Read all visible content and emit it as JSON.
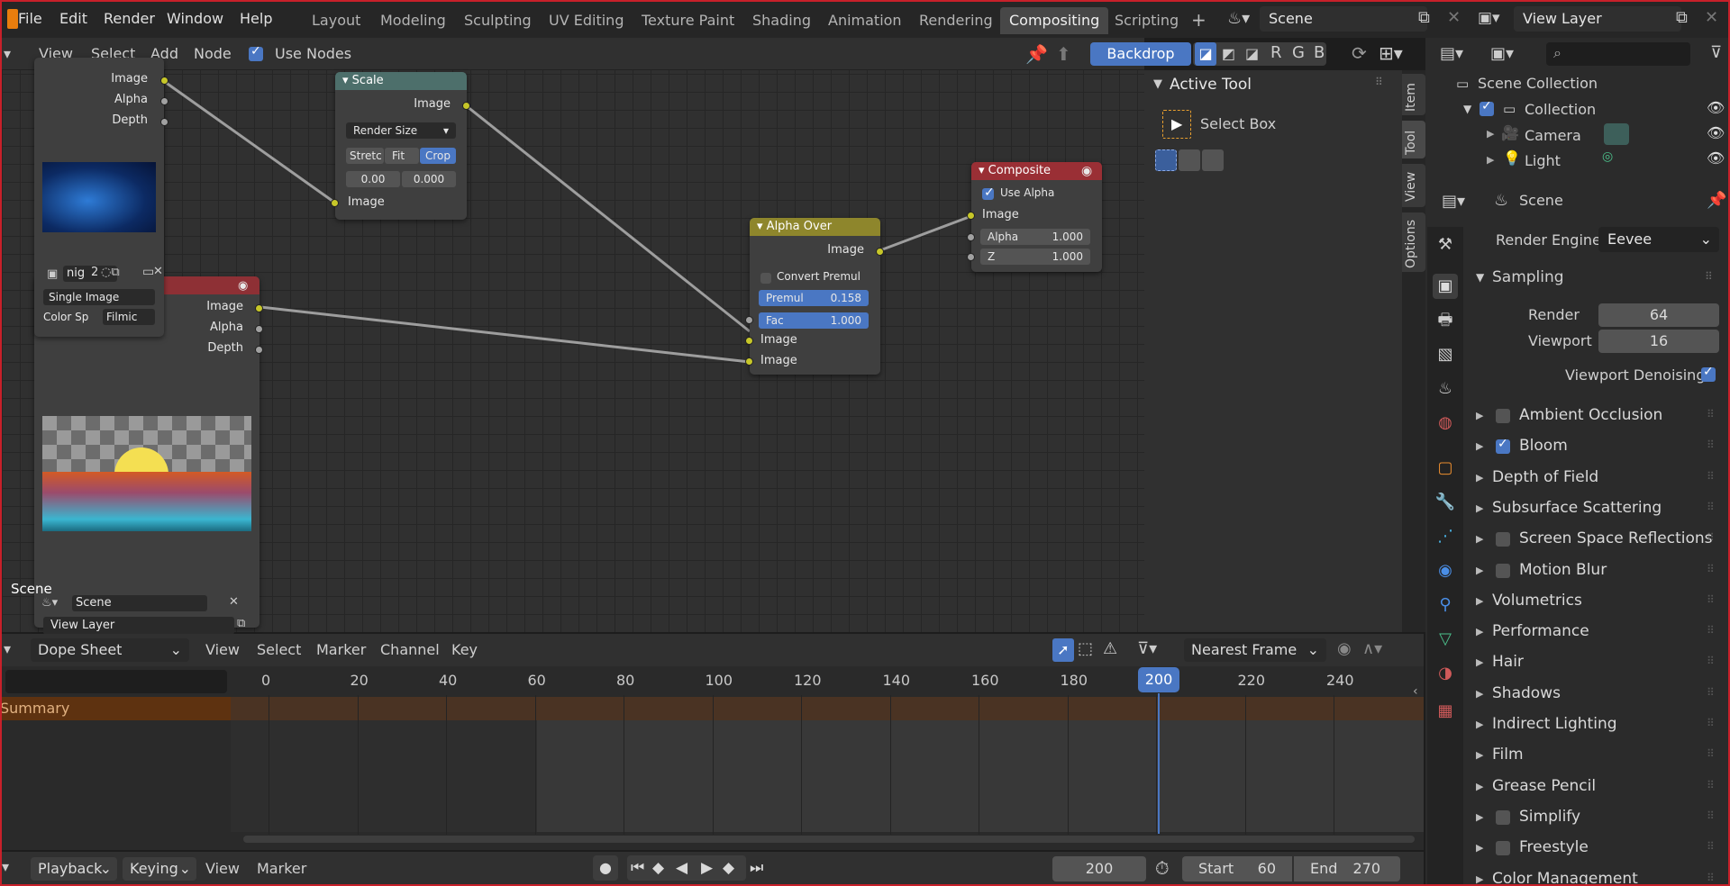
{
  "top_menu": [
    "File",
    "Edit",
    "Render",
    "Window",
    "Help"
  ],
  "workspaces": [
    "Layout",
    "Modeling",
    "Sculpting",
    "UV Editing",
    "Texture Paint",
    "Shading",
    "Animation",
    "Rendering",
    "Compositing",
    "Scripting"
  ],
  "active_workspace": "Compositing",
  "scene_name": "Scene",
  "view_layer": "View Layer",
  "node_header": {
    "items": [
      "View",
      "Select",
      "Add",
      "Node"
    ],
    "use_nodes": "Use Nodes",
    "backdrop": "Backdrop",
    "channels": [
      "R",
      "G",
      "B"
    ]
  },
  "nodes": {
    "render_layers": {
      "outputs": [
        "Image",
        "Alpha",
        "Depth"
      ],
      "scene": "Scene",
      "scene_label": "Scene",
      "view_layer": "View Layer"
    },
    "image_node": {
      "outputs": [
        "Image",
        "Alpha",
        "Depth"
      ],
      "image_name": "nig",
      "users": "2",
      "source": "Single Image",
      "color_space_label": "Color Sp",
      "color_space": "Filmic"
    },
    "scale": {
      "title": "Scale",
      "out": "Image",
      "space": "Render Size",
      "modes": [
        "Stretc",
        "Fit",
        "Crop"
      ],
      "x": "0.00",
      "y": "0.000",
      "in": "Image"
    },
    "alpha_over": {
      "title": "Alpha Over",
      "out": "Image",
      "convert": "Convert Premul",
      "premul_label": "Premul",
      "premul": "0.158",
      "fac_label": "Fac",
      "fac": "1.000",
      "in1": "Image",
      "in2": "Image"
    },
    "composite": {
      "title": "Composite",
      "use_alpha": "Use Alpha",
      "in": "Image",
      "alpha_label": "Alpha",
      "alpha": "1.000",
      "z_label": "Z",
      "z": "1.000"
    }
  },
  "npanel": {
    "title": "Active Tool",
    "tool": "Select Box",
    "tabs": [
      "Item",
      "Tool",
      "View",
      "Options"
    ]
  },
  "outliner": {
    "root": "Scene Collection",
    "collection": "Collection",
    "items": [
      "Camera",
      "Light"
    ]
  },
  "properties": {
    "scene": "Scene",
    "render_engine_label": "Render Engine",
    "render_engine": "Eevee",
    "sampling": "Sampling",
    "render_label": "Render",
    "render": "64",
    "viewport_label": "Viewport",
    "viewport": "16",
    "denoise": "Viewport Denoising",
    "panels": [
      {
        "name": "Ambient Occlusion",
        "check": true,
        "on": false
      },
      {
        "name": "Bloom",
        "check": true,
        "on": true
      },
      {
        "name": "Depth of Field",
        "check": false,
        "on": false
      },
      {
        "name": "Subsurface Scattering",
        "check": false,
        "on": false
      },
      {
        "name": "Screen Space Reflections",
        "check": true,
        "on": false
      },
      {
        "name": "Motion Blur",
        "check": true,
        "on": false
      },
      {
        "name": "Volumetrics",
        "check": false,
        "on": false
      },
      {
        "name": "Performance",
        "check": false,
        "on": false
      },
      {
        "name": "Hair",
        "check": false,
        "on": false
      },
      {
        "name": "Shadows",
        "check": false,
        "on": false
      },
      {
        "name": "Indirect Lighting",
        "check": false,
        "on": false
      },
      {
        "name": "Film",
        "check": false,
        "on": false
      },
      {
        "name": "Grease Pencil",
        "check": false,
        "on": false
      },
      {
        "name": "Simplify",
        "check": true,
        "on": false
      },
      {
        "name": "Freestyle",
        "check": true,
        "on": false
      },
      {
        "name": "Color Management",
        "check": false,
        "on": false
      }
    ]
  },
  "dope": {
    "mode": "Dope Sheet",
    "menus": [
      "View",
      "Select",
      "Marker",
      "Channel",
      "Key"
    ],
    "snap": "Nearest Frame",
    "summary": "Summary",
    "ticks": [
      "0",
      "20",
      "40",
      "60",
      "80",
      "100",
      "120",
      "140",
      "160",
      "180",
      "200",
      "220",
      "240"
    ],
    "current": "200"
  },
  "timeline": {
    "menus": [
      "Playback",
      "Keying",
      "View",
      "Marker"
    ],
    "frame": "200",
    "start_label": "Start",
    "start": "60",
    "end_label": "End",
    "end": "270"
  },
  "colors": {
    "accent": "#4a77c3",
    "socket": "#c7c729",
    "composite_header": "#9a2f35",
    "alpha_header": "#8e862c",
    "scale_header": "#4d6f6b"
  }
}
